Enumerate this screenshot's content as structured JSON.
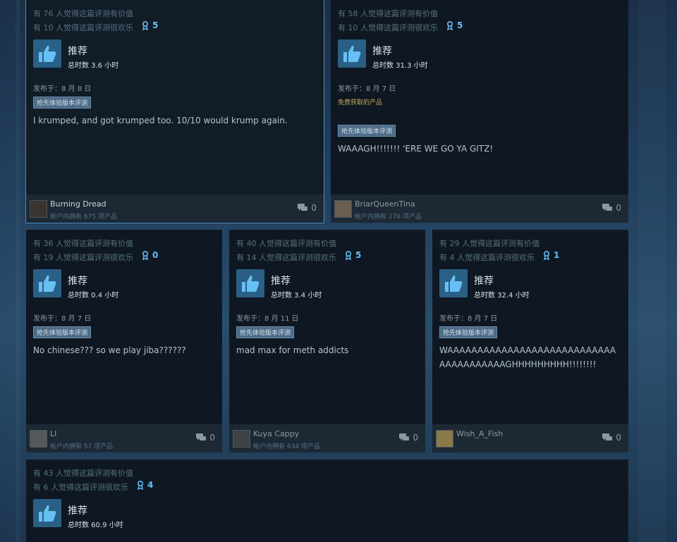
{
  "reviews": [
    {
      "helpful": "有 76 人觉得这篇评测有价值",
      "funny": "有 10 人觉得这篇评测很欢乐",
      "awards": "5",
      "recommendation": "推荐",
      "hours": "总时数 3.6 小时",
      "posted": "发布于：8 月 8 日",
      "early_access": "抢先体验版本评测",
      "text": "I krumped, and got krumped too. 10/10 would krump again.",
      "user": "Burning Dread",
      "products": "帐户内拥有 675 项产品",
      "comments": "0"
    },
    {
      "helpful": "有 58 人觉得这篇评测有价值",
      "funny": "有 10 人觉得这篇评测很欢乐",
      "awards": "5",
      "recommendation": "推荐",
      "hours": "总时数 31.3 小时",
      "posted": "发布于：8 月 7 日",
      "free_product": "免费获取的产品",
      "early_access": "抢先体验版本评测",
      "text": "WAAAGH!!!!!!! 'ERE WE GO YA GITZ!",
      "user": "BriarQueenTina",
      "products": "帐户内拥有 276 项产品",
      "comments": "0"
    },
    {
      "helpful": "有 36 人觉得这篇评测有价值",
      "funny": "有 19 人觉得这篇评测很欢乐",
      "awards": "0",
      "recommendation": "推荐",
      "hours": "总时数 0.4 小时",
      "posted": "发布于：8 月 7 日",
      "early_access": "抢先体验版本评测",
      "text": "No chinese??? so we play jiba??????",
      "user": "LI",
      "products": "帐户内拥有 57 项产品",
      "comments": "0"
    },
    {
      "helpful": "有 40 人觉得这篇评测有价值",
      "funny": "有 14 人觉得这篇评测很欢乐",
      "awards": "5",
      "recommendation": "推荐",
      "hours": "总时数 3.4 小时",
      "posted": "发布于：8 月 11 日",
      "early_access": "抢先体验版本评测",
      "text": "mad max for meth addicts",
      "user": "Kuya Cappy",
      "products": "帐户内拥有 634 项产品",
      "comments": "0"
    },
    {
      "helpful": "有 29 人觉得这篇评测有价值",
      "funny": "有 4 人觉得这篇评测很欢乐",
      "awards": "1",
      "recommendation": "推荐",
      "hours": "总时数 32.4 小时",
      "posted": "发布于：8 月 7 日",
      "early_access": "抢先体验版本评测",
      "text": "WAAAAAAAAAAAAAAAAAAAAAAAAAAAAAAAAAAAAAAAGHHHHHHHHH!!!!!!!!",
      "user": "Wish_A_Fish",
      "products": "",
      "comments": "0"
    },
    {
      "helpful": "有 43 人觉得这篇评测有价值",
      "funny": "有 6 人觉得这篇评测很欢乐",
      "awards": "4",
      "recommendation": "推荐",
      "hours": "总时数 60.9 小时"
    }
  ],
  "colors": {
    "accent": "#66c0f4",
    "card_bg": "#0f1822",
    "footer_bg": "#1c2935",
    "thumb_bg": "#2a5f86"
  },
  "icons": {
    "thumb": "thumbs-up-icon",
    "award": "award-ribbon-icon",
    "comment": "comment-bubble-icon"
  }
}
